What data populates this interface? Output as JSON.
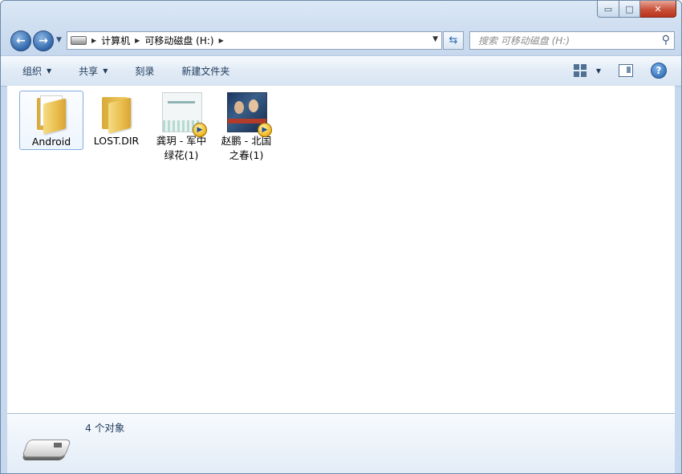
{
  "window": {
    "caption_buttons": {
      "minimize": "▭",
      "maximize": "□",
      "close": "✕"
    }
  },
  "nav": {
    "back_icon": "back-arrow-icon",
    "forward_icon": "forward-arrow-icon",
    "back_glyph": "←",
    "forward_glyph": "→",
    "recent_glyph": "▼",
    "breadcrumb": [
      "计算机",
      "可移动磁盘 (H:)"
    ],
    "crumb_sep": "▶",
    "dropdown_glyph": "▼",
    "refresh_glyph": "⇆",
    "search_placeholder": "搜索 可移动磁盘 (H:)",
    "search_glyph": "⚲"
  },
  "toolbar": {
    "organize_label": "组织",
    "share_label": "共享",
    "burn_label": "刻录",
    "new_folder_label": "新建文件夹",
    "caret": "▼",
    "help_glyph": "?"
  },
  "items": [
    {
      "label_line1": "Android",
      "label_line2": "",
      "type": "folder",
      "selected": true
    },
    {
      "label_line1": "LOST.DIR",
      "label_line2": "",
      "type": "folder",
      "selected": false
    },
    {
      "label_line1": "龚玥 - 军中",
      "label_line2": "绿花(1)",
      "type": "media",
      "selected": false
    },
    {
      "label_line1": "赵鹏 - 北国",
      "label_line2": "之春(1)",
      "type": "media",
      "selected": false
    }
  ],
  "details": {
    "status": "4 个对象"
  },
  "colors": {
    "accent": "#1e395b",
    "selection_border": "#84acdd",
    "close_button": "#c8503a",
    "folder": "#e9bd4c"
  }
}
